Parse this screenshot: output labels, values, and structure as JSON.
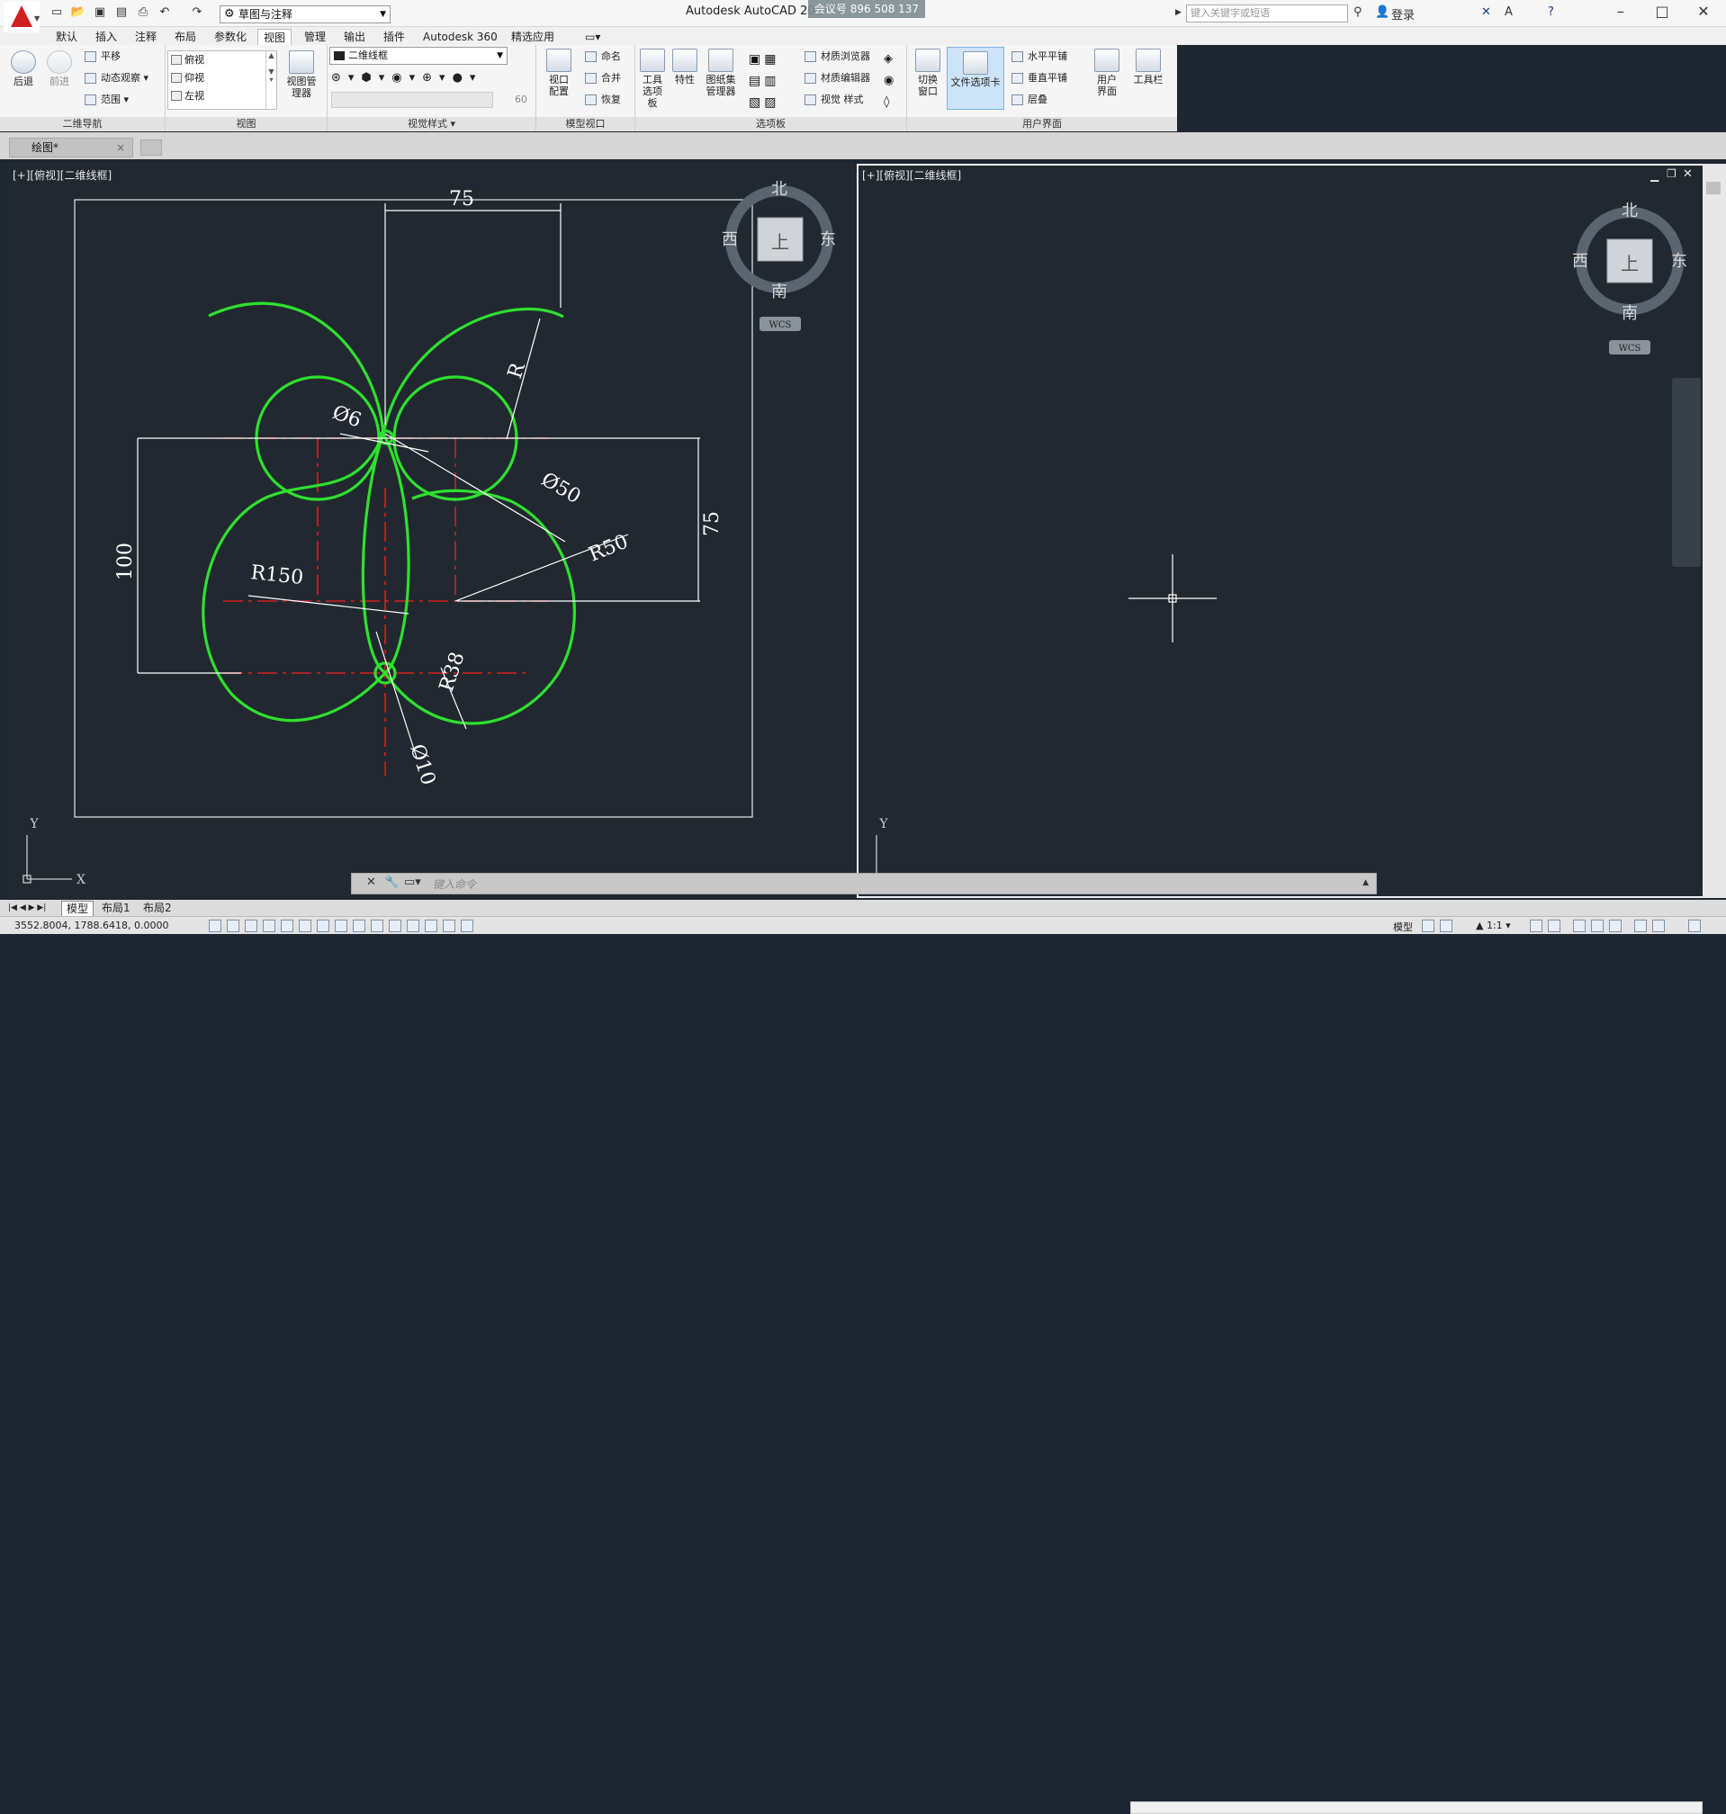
{
  "title_bar": {
    "app_title": "Autodesk AutoCAD 201",
    "meeting_overlay": "会议号 896 508 137",
    "workspace": "草图与注释",
    "search_placeholder": "键入关键字或短语",
    "login": "登录"
  },
  "menu_tabs": [
    "默认",
    "插入",
    "注释",
    "布局",
    "参数化",
    "视图",
    "管理",
    "输出",
    "插件",
    "Autodesk 360",
    "精选应用"
  ],
  "active_menu_tab": "视图",
  "ribbon": {
    "nav2d": {
      "title": "二维导航",
      "back": "后退",
      "forward": "前进",
      "pan": "平移",
      "orbit": "动态观察",
      "extents": "范围"
    },
    "views": {
      "title": "视图",
      "items": [
        "俯视",
        "仰视",
        "左视"
      ],
      "manager": "视图管理器"
    },
    "visual_styles": {
      "title": "视觉样式",
      "current": "二维线框",
      "opacity_value": "60"
    },
    "model_viewports": {
      "title": "模型视口",
      "config": "视口配置",
      "named": "命名",
      "join": "合并",
      "restore": "恢复"
    },
    "palettes": {
      "title": "选项板",
      "tool_palettes": "工具选项板",
      "properties": "特性",
      "sheetset": "图纸集管理器"
    },
    "palettes2": {
      "mat_browser": "材质浏览器",
      "mat_editor": "材质编辑器",
      "visual_styles": "视觉 样式"
    },
    "ui": {
      "title": "用户界面",
      "switch": "切换窗口",
      "file_tabs": "文件选项卡",
      "tile_h": "水平平铺",
      "tile_v": "垂直平铺",
      "cascade": "层叠",
      "user_interface": "用户界面",
      "toolbars": "工具栏"
    }
  },
  "document_tab": "绘图*",
  "viewport_left": {
    "label": "[+][俯视][二维线框]"
  },
  "viewport_right": {
    "label": "[+][俯视][二维线框]"
  },
  "viewcube": {
    "north": "北",
    "south": "南",
    "east": "东",
    "west": "西",
    "top": "上",
    "wcs": "WCS"
  },
  "ucs": {
    "x": "X",
    "y": "Y"
  },
  "drawing": {
    "dim_top": "75",
    "dim_right": "75",
    "dim_left": "100",
    "radius_top": "R",
    "dia_6": "Ø6",
    "dia_50": "Ø50",
    "r150": "R150",
    "r50": "R50",
    "r38": "R38",
    "dia_10": "Ø10"
  },
  "command_line": {
    "placeholder": "键入命令"
  },
  "layout_tabs": [
    "模型",
    "布局1",
    "布局2"
  ],
  "active_layout": "模型",
  "status": {
    "coordinates": "3552.8004, 1788.6418, 0.0000",
    "model": "模型",
    "scale": "1:1"
  },
  "colors": {
    "geometry": "#2fe02f",
    "centerline": "#d42020",
    "dimension": "#ffffff",
    "viewport_bg": "#212830"
  }
}
